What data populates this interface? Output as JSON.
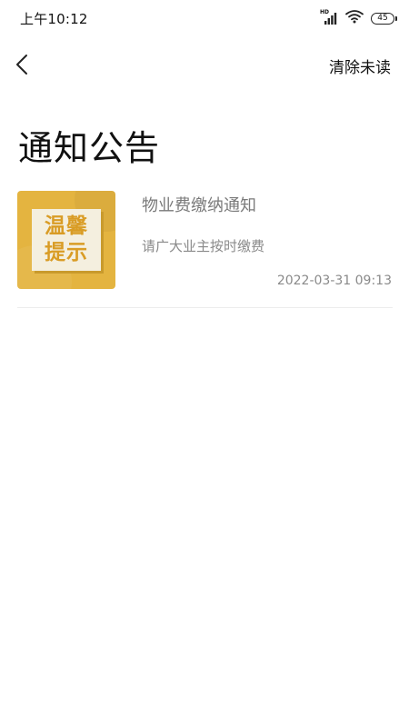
{
  "status_bar": {
    "time": "上午10:12",
    "network_label": "HD",
    "battery_level": "45"
  },
  "nav": {
    "back_icon": "chevron-left-icon",
    "clear_unread_label": "清除未读"
  },
  "page": {
    "title": "通知公告"
  },
  "notices": [
    {
      "thumbnail_lines": [
        "温馨",
        "提示"
      ],
      "title": "物业费缴纳通知",
      "summary": "请广大业主按时缴费",
      "time": "2022-03-31 09:13"
    }
  ],
  "colors": {
    "thumbnail_background": "#e4b440",
    "thumbnail_text": "#d99c25",
    "secondary_text": "#8a8a8a"
  }
}
